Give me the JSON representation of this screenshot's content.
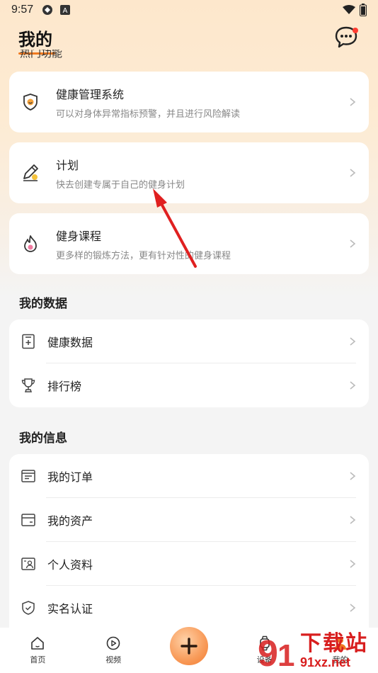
{
  "status_bar": {
    "time": "9:57"
  },
  "header": {
    "title": "我的"
  },
  "hot_section": {
    "title": "热门功能"
  },
  "features": [
    {
      "title": "健康管理系统",
      "subtitle": "可以对身体异常指标预警，并且进行风险解读",
      "icon": "shield-smile-icon"
    },
    {
      "title": "计划",
      "subtitle": "快去创建专属于自己的健身计划",
      "icon": "pencil-icon"
    },
    {
      "title": "健身课程",
      "subtitle": "更多样的锻炼方法，更有针对性的健身课程",
      "icon": "flame-icon"
    }
  ],
  "my_data": {
    "title": "我的数据",
    "items": [
      {
        "label": "健康数据",
        "icon": "data-card-icon"
      },
      {
        "label": "排行榜",
        "icon": "trophy-icon"
      }
    ]
  },
  "my_info": {
    "title": "我的信息",
    "items": [
      {
        "label": "我的订单",
        "icon": "order-icon"
      },
      {
        "label": "我的资产",
        "icon": "wallet-icon"
      },
      {
        "label": "个人资料",
        "icon": "profile-card-icon"
      },
      {
        "label": "实名认证",
        "icon": "verified-shield-icon"
      }
    ]
  },
  "bottom_nav": [
    {
      "label": "首页",
      "icon": "home-icon"
    },
    {
      "label": "视频",
      "icon": "play-icon"
    },
    {
      "label": "",
      "icon": "plus-icon"
    },
    {
      "label": "设备",
      "icon": "watch-icon"
    },
    {
      "label": "我的",
      "icon": "user-icon"
    }
  ],
  "watermark": {
    "cn": "下载站",
    "en": "91xz.net"
  },
  "colors": {
    "accent": "#f07a20",
    "badge": "#ff3b30",
    "arrow": "#e02020",
    "watermark": "#d81e1e"
  }
}
